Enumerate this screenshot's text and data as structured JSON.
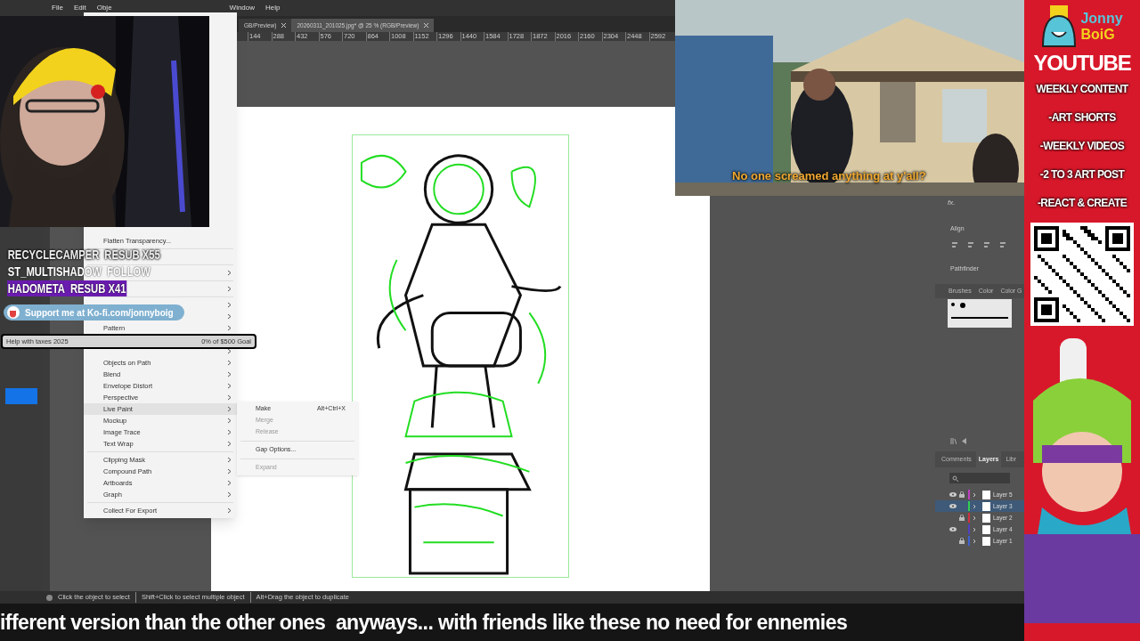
{
  "menubar": [
    "File",
    "Edit",
    "Obje",
    "Window",
    "Help"
  ],
  "doc_tabs": [
    {
      "label": "GB/Preview)",
      "selected": false
    },
    {
      "label": "20260311_201025.jpg* @ 25 % (RGB/Preview)",
      "selected": true
    }
  ],
  "ruler_ticks": [
    "144",
    "288",
    "432",
    "576",
    "720",
    "864",
    "1008",
    "1152",
    "1296",
    "1440",
    "1584",
    "1728",
    "1872",
    "2016",
    "2160",
    "2304",
    "2448",
    "2592"
  ],
  "object_menu": [
    {
      "kind": "item",
      "label": "Flatten Transparency...",
      "disabled": false,
      "selected": false,
      "submenu": false
    },
    {
      "kind": "separator"
    },
    {
      "kind": "covered",
      "submenu": false
    },
    {
      "kind": "separator"
    },
    {
      "kind": "covered",
      "submenu": true
    },
    {
      "kind": "separator"
    },
    {
      "kind": "covered",
      "submenu": true
    },
    {
      "kind": "separator"
    },
    {
      "kind": "covered",
      "submenu": true
    },
    {
      "kind": "covered",
      "submenu": true
    },
    {
      "kind": "item",
      "label": "Pattern",
      "disabled": false,
      "selected": false,
      "submenu": true
    },
    {
      "kind": "covered"
    },
    {
      "kind": "covered",
      "submenu": true
    },
    {
      "kind": "item",
      "label": "Objects on Path",
      "disabled": false,
      "selected": false,
      "submenu": true
    },
    {
      "kind": "item",
      "label": "Blend",
      "disabled": false,
      "selected": false,
      "submenu": true
    },
    {
      "kind": "item",
      "label": "Envelope Distort",
      "disabled": false,
      "selected": false,
      "submenu": true
    },
    {
      "kind": "item",
      "label": "Perspective",
      "disabled": false,
      "selected": false,
      "submenu": true
    },
    {
      "kind": "item",
      "label": "Live Paint",
      "disabled": false,
      "selected": true,
      "submenu": true
    },
    {
      "kind": "item",
      "label": "Mockup",
      "disabled": false,
      "selected": false,
      "submenu": true
    },
    {
      "kind": "item",
      "label": "Image Trace",
      "disabled": false,
      "selected": false,
      "submenu": true
    },
    {
      "kind": "item",
      "label": "Text Wrap",
      "disabled": false,
      "selected": false,
      "submenu": true
    },
    {
      "kind": "separator"
    },
    {
      "kind": "item",
      "label": "Clipping Mask",
      "disabled": false,
      "selected": false,
      "submenu": true
    },
    {
      "kind": "item",
      "label": "Compound Path",
      "disabled": false,
      "selected": false,
      "submenu": true
    },
    {
      "kind": "item",
      "label": "Artboards",
      "disabled": false,
      "selected": false,
      "submenu": true
    },
    {
      "kind": "item",
      "label": "Graph",
      "disabled": false,
      "selected": false,
      "submenu": true
    },
    {
      "kind": "separator"
    },
    {
      "kind": "item",
      "label": "Collect For Export",
      "disabled": false,
      "selected": false,
      "submenu": true
    }
  ],
  "live_paint_submenu": [
    {
      "kind": "item",
      "label": "Make",
      "shortcut": "Alt+Ctrl+X",
      "disabled": false
    },
    {
      "kind": "item",
      "label": "Merge",
      "disabled": true
    },
    {
      "kind": "item",
      "label": "Release",
      "disabled": true
    },
    {
      "kind": "separator"
    },
    {
      "kind": "item",
      "label": "Gap Options...",
      "disabled": false
    },
    {
      "kind": "separator"
    },
    {
      "kind": "item",
      "label": "Expand",
      "disabled": true
    }
  ],
  "chat_alerts": [
    {
      "kind": "faded",
      "name": "RECYCLECAMPER",
      "action": "RESUB X55"
    },
    {
      "kind": "plain",
      "name": "ST_MULTISHADOW",
      "action": "FOLLOW"
    },
    {
      "kind": "highlight",
      "name": "HADOMETA",
      "action": "RESUB X41"
    }
  ],
  "support_pill": "Support me at Ko-fi.com/jonnyboig",
  "goal": {
    "title": "Help with taxes 2025",
    "reading": "0% of $500 Goal",
    "level": 0
  },
  "video_caption": "No one screamed anything at y'all?",
  "right_panel": {
    "fx": "fx.",
    "align": "Align",
    "pathfinder": "Pathfinder",
    "brush_tabs": [
      "Brushes",
      "Color",
      "Color G"
    ],
    "layer_tabs": [
      {
        "label": "Comments",
        "selected": false
      },
      {
        "label": "Layers",
        "selected": true
      },
      {
        "label": "Libr",
        "selected": false
      }
    ],
    "layers": [
      {
        "name": "Layer 5",
        "visible": true,
        "locked": true,
        "selected": false,
        "color": "#c040c0"
      },
      {
        "name": "Layer 3",
        "visible": true,
        "locked": false,
        "selected": true,
        "color": "#30d050"
      },
      {
        "name": "Layer 2",
        "visible": false,
        "locked": true,
        "selected": false,
        "color": "#d03040"
      },
      {
        "name": "Layer 4",
        "visible": true,
        "locked": false,
        "selected": false,
        "color": "#5040c0"
      },
      {
        "name": "Layer 1",
        "visible": false,
        "locked": true,
        "selected": false,
        "color": "#4060d0"
      }
    ]
  },
  "status_hints": [
    "Click the object to select",
    "Shift+Click to select multiple object",
    "Alt+Drag the object to duplicate"
  ],
  "subtitle": "ifferent version than the other ones  anyways... with friends like these no need for ennemies",
  "banner": {
    "logo_top": "Jonny",
    "logo_bottom": "BoiG",
    "title": "YOUTUBE",
    "lines": [
      "WEEKLY CONTENT",
      "-ART SHORTS",
      "-WEEKLY VIDEOS",
      "-2 TO 3 ART POST",
      "-REACT & CREATE"
    ]
  }
}
